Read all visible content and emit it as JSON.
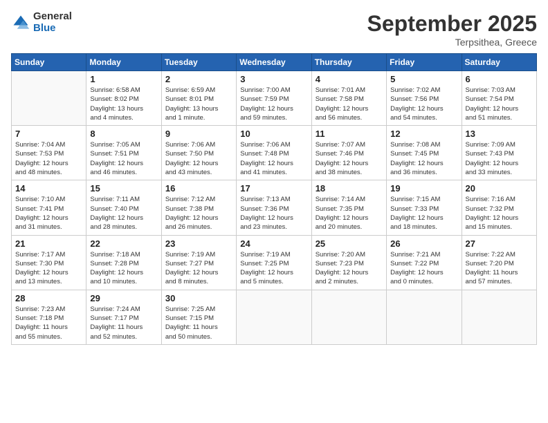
{
  "logo": {
    "general": "General",
    "blue": "Blue"
  },
  "title": "September 2025",
  "location": "Terpsithea, Greece",
  "weekdays": [
    "Sunday",
    "Monday",
    "Tuesday",
    "Wednesday",
    "Thursday",
    "Friday",
    "Saturday"
  ],
  "weeks": [
    [
      {
        "day": "",
        "info": ""
      },
      {
        "day": "1",
        "info": "Sunrise: 6:58 AM\nSunset: 8:02 PM\nDaylight: 13 hours\nand 4 minutes."
      },
      {
        "day": "2",
        "info": "Sunrise: 6:59 AM\nSunset: 8:01 PM\nDaylight: 13 hours\nand 1 minute."
      },
      {
        "day": "3",
        "info": "Sunrise: 7:00 AM\nSunset: 7:59 PM\nDaylight: 12 hours\nand 59 minutes."
      },
      {
        "day": "4",
        "info": "Sunrise: 7:01 AM\nSunset: 7:58 PM\nDaylight: 12 hours\nand 56 minutes."
      },
      {
        "day": "5",
        "info": "Sunrise: 7:02 AM\nSunset: 7:56 PM\nDaylight: 12 hours\nand 54 minutes."
      },
      {
        "day": "6",
        "info": "Sunrise: 7:03 AM\nSunset: 7:54 PM\nDaylight: 12 hours\nand 51 minutes."
      }
    ],
    [
      {
        "day": "7",
        "info": "Sunrise: 7:04 AM\nSunset: 7:53 PM\nDaylight: 12 hours\nand 48 minutes."
      },
      {
        "day": "8",
        "info": "Sunrise: 7:05 AM\nSunset: 7:51 PM\nDaylight: 12 hours\nand 46 minutes."
      },
      {
        "day": "9",
        "info": "Sunrise: 7:06 AM\nSunset: 7:50 PM\nDaylight: 12 hours\nand 43 minutes."
      },
      {
        "day": "10",
        "info": "Sunrise: 7:06 AM\nSunset: 7:48 PM\nDaylight: 12 hours\nand 41 minutes."
      },
      {
        "day": "11",
        "info": "Sunrise: 7:07 AM\nSunset: 7:46 PM\nDaylight: 12 hours\nand 38 minutes."
      },
      {
        "day": "12",
        "info": "Sunrise: 7:08 AM\nSunset: 7:45 PM\nDaylight: 12 hours\nand 36 minutes."
      },
      {
        "day": "13",
        "info": "Sunrise: 7:09 AM\nSunset: 7:43 PM\nDaylight: 12 hours\nand 33 minutes."
      }
    ],
    [
      {
        "day": "14",
        "info": "Sunrise: 7:10 AM\nSunset: 7:41 PM\nDaylight: 12 hours\nand 31 minutes."
      },
      {
        "day": "15",
        "info": "Sunrise: 7:11 AM\nSunset: 7:40 PM\nDaylight: 12 hours\nand 28 minutes."
      },
      {
        "day": "16",
        "info": "Sunrise: 7:12 AM\nSunset: 7:38 PM\nDaylight: 12 hours\nand 26 minutes."
      },
      {
        "day": "17",
        "info": "Sunrise: 7:13 AM\nSunset: 7:36 PM\nDaylight: 12 hours\nand 23 minutes."
      },
      {
        "day": "18",
        "info": "Sunrise: 7:14 AM\nSunset: 7:35 PM\nDaylight: 12 hours\nand 20 minutes."
      },
      {
        "day": "19",
        "info": "Sunrise: 7:15 AM\nSunset: 7:33 PM\nDaylight: 12 hours\nand 18 minutes."
      },
      {
        "day": "20",
        "info": "Sunrise: 7:16 AM\nSunset: 7:32 PM\nDaylight: 12 hours\nand 15 minutes."
      }
    ],
    [
      {
        "day": "21",
        "info": "Sunrise: 7:17 AM\nSunset: 7:30 PM\nDaylight: 12 hours\nand 13 minutes."
      },
      {
        "day": "22",
        "info": "Sunrise: 7:18 AM\nSunset: 7:28 PM\nDaylight: 12 hours\nand 10 minutes."
      },
      {
        "day": "23",
        "info": "Sunrise: 7:19 AM\nSunset: 7:27 PM\nDaylight: 12 hours\nand 8 minutes."
      },
      {
        "day": "24",
        "info": "Sunrise: 7:19 AM\nSunset: 7:25 PM\nDaylight: 12 hours\nand 5 minutes."
      },
      {
        "day": "25",
        "info": "Sunrise: 7:20 AM\nSunset: 7:23 PM\nDaylight: 12 hours\nand 2 minutes."
      },
      {
        "day": "26",
        "info": "Sunrise: 7:21 AM\nSunset: 7:22 PM\nDaylight: 12 hours\nand 0 minutes."
      },
      {
        "day": "27",
        "info": "Sunrise: 7:22 AM\nSunset: 7:20 PM\nDaylight: 11 hours\nand 57 minutes."
      }
    ],
    [
      {
        "day": "28",
        "info": "Sunrise: 7:23 AM\nSunset: 7:18 PM\nDaylight: 11 hours\nand 55 minutes."
      },
      {
        "day": "29",
        "info": "Sunrise: 7:24 AM\nSunset: 7:17 PM\nDaylight: 11 hours\nand 52 minutes."
      },
      {
        "day": "30",
        "info": "Sunrise: 7:25 AM\nSunset: 7:15 PM\nDaylight: 11 hours\nand 50 minutes."
      },
      {
        "day": "",
        "info": ""
      },
      {
        "day": "",
        "info": ""
      },
      {
        "day": "",
        "info": ""
      },
      {
        "day": "",
        "info": ""
      }
    ]
  ]
}
